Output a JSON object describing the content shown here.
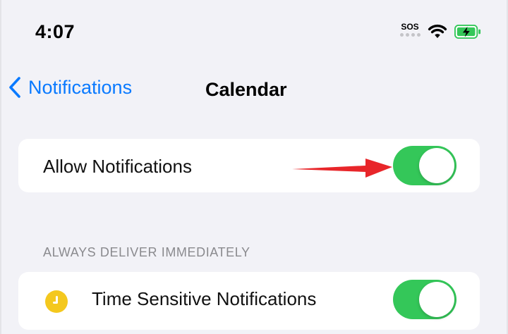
{
  "status_bar": {
    "time": "4:07",
    "sos": "SOS",
    "icons": [
      "sos-signal-icon",
      "wifi-icon",
      "battery-charging-icon"
    ],
    "battery_color": "#34c759"
  },
  "nav": {
    "back_label": "Notifications",
    "title": "Calendar",
    "accent_color": "#0a7aff"
  },
  "allow_notifications": {
    "label": "Allow Notifications",
    "enabled": true
  },
  "section": {
    "header": "ALWAYS DELIVER IMMEDIATELY"
  },
  "time_sensitive": {
    "label": "Time Sensitive Notifications",
    "enabled": true,
    "icon": "clock-icon",
    "icon_color": "#f4c81e"
  },
  "annotation": {
    "arrow_color": "#e8262a",
    "icon": "red-arrow-icon"
  },
  "toggle_on_color": "#34c759"
}
